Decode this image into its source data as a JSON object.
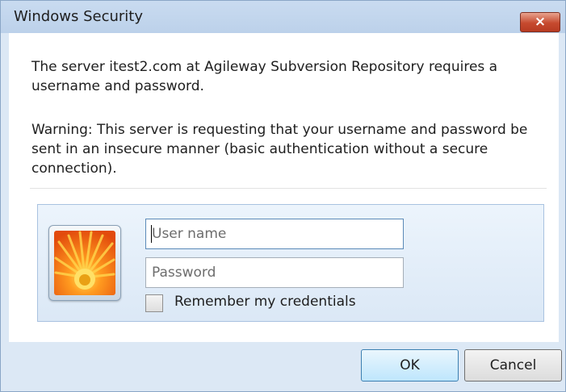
{
  "window": {
    "title": "Windows Security",
    "close_label": "×"
  },
  "message": {
    "line1": "The server itest2.com at Agileway Subversion Repository requires a username and password.",
    "warning": "Warning: This server is requesting that your username and password be sent in an insecure manner (basic authentication without a secure connection)."
  },
  "credentials": {
    "user_tile_icon": "user-picture-flower-icon",
    "username_placeholder": "User name",
    "username_value": "",
    "password_placeholder": "Password",
    "password_value": "",
    "remember_label": "Remember my credentials",
    "remember_checked": false
  },
  "buttons": {
    "ok_label": "OK",
    "cancel_label": "Cancel"
  },
  "colors": {
    "window_frame": "#dce8f5",
    "close_button": "#c64a2f",
    "ok_button_border": "#3c7fb1"
  }
}
